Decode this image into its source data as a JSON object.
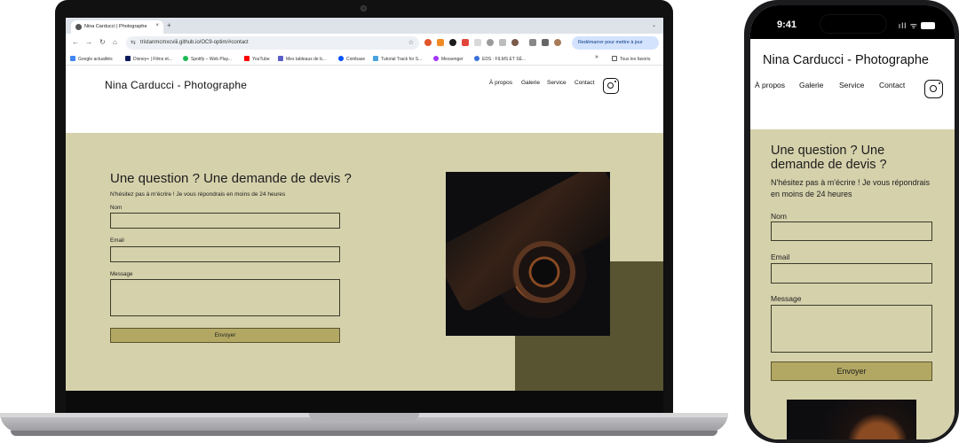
{
  "browser": {
    "tab_title": "Nina Carducci | Photographe",
    "tab_close": "×",
    "tab_new": "+",
    "tab_menu": "⌄",
    "nav": {
      "back": "←",
      "forward": "→",
      "reload": "↻",
      "home": "⌂"
    },
    "url": "tristanmcmxcviii.github.io/OC9-optim/#contact",
    "site_info_icon": "⇆",
    "bookmark_star": "☆",
    "restart_label": "Redémarrer pour mettre à jour",
    "bookmarks": [
      {
        "label": "Google actualités",
        "color": "#4285f4"
      },
      {
        "label": "Disney+ | Films et...",
        "color": "#0e1a5a"
      },
      {
        "label": "Spotify – Web Play...",
        "color": "#1db954"
      },
      {
        "label": "YouTube",
        "color": "#ff0000"
      },
      {
        "label": "Mes tableaux de b...",
        "color": "#5b5fc7"
      },
      {
        "label": "Coinbase",
        "color": "#0052ff"
      },
      {
        "label": "Tutorial Track for S...",
        "color": "#4aa3df"
      },
      {
        "label": "Messenger",
        "color": "#a334fa"
      },
      {
        "label": "EDS : FILMS ET SÉ...",
        "color": "#3a6fd8"
      }
    ],
    "bookmarks_more": "»",
    "all_bookmarks": "Tous les favoris"
  },
  "site": {
    "brand": "Nina Carducci - Photographe",
    "nav": [
      "À propos",
      "Galerie",
      "Service",
      "Contact"
    ],
    "contact": {
      "heading": "Une question ? Une demande de devis ?",
      "lead": "N'hésitez pas à m'écrire ! Je vous répondrais en moins de 24 heures",
      "name_label": "Nom",
      "email_label": "Email",
      "message_label": "Message",
      "submit_label": "Envoyer"
    },
    "colors": {
      "section_bg": "#d5d1ab",
      "button_bg": "#b3a863",
      "accent_block": "#585432"
    }
  },
  "phone": {
    "time": "9:41",
    "signal_icons": "ıll ᯤ"
  }
}
